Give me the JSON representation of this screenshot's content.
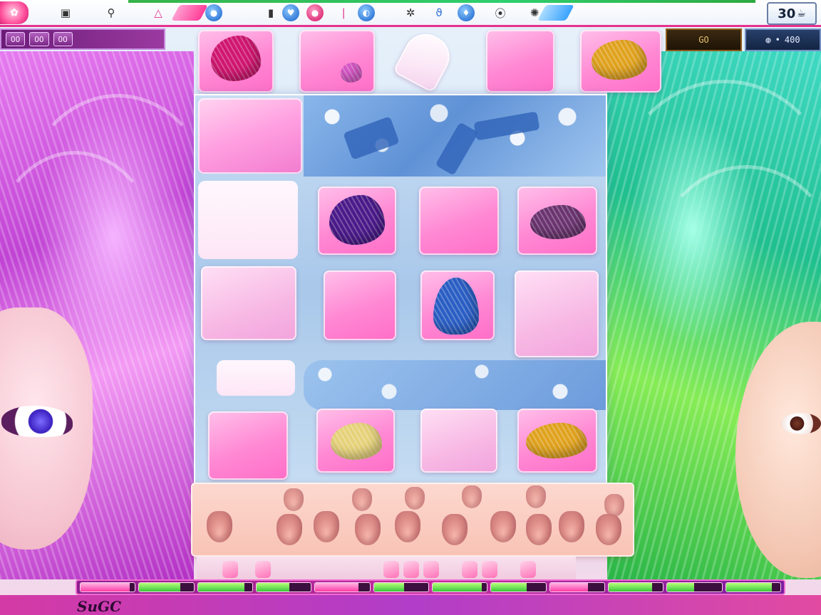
{
  "toolbar": {
    "counter_text": "30",
    "counter_icon": "teapot-icon",
    "icons": [
      "logo-icon",
      "monitor-icon",
      "person-icon",
      "triangle-icon",
      "coin-icon",
      "battery-icon",
      "heart-icon",
      "pin-icon",
      "moon-icon",
      "chat-icon",
      "drop-icon",
      "bracket-icon",
      "gear-icon"
    ]
  },
  "status_left": {
    "slot_a": "OO",
    "slot_b": "OO",
    "slot_c": "OO"
  },
  "status_right": {
    "gold_box": "GO",
    "score_box": "400"
  },
  "hud": {
    "levels": [
      0.9,
      0.75,
      0.85,
      0.6,
      0.8,
      0.55,
      0.9,
      0.65,
      0.7,
      0.8,
      0.5,
      0.85
    ]
  },
  "colors": {
    "accent_pink": "#e6318e",
    "panel_blue": "#a9c8ea",
    "hair_magenta": "#d01670",
    "hair_purple": "#4a1a8a",
    "hair_blue": "#2a5ec4",
    "hair_gold": "#e0a21e",
    "hair_cream": "#e6d27a",
    "hair_mauve": "#6b3470"
  },
  "footer": {
    "label": "SuGC"
  }
}
